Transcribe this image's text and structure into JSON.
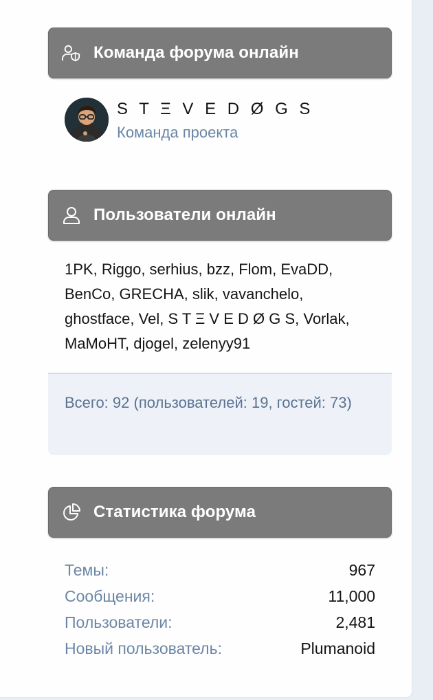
{
  "staff_block": {
    "title": "Команда форума онлайн",
    "icon": "user-shield-icon",
    "members": [
      {
        "name": "S T Ξ V E D Ø G S",
        "role": "Команда проекта"
      }
    ]
  },
  "online_block": {
    "title": "Пользователи онлайн",
    "icon": "user-icon",
    "users": [
      "1PK",
      "Riggo",
      "serhius",
      "bzz",
      "Flom",
      "EvaDD",
      "BenCo",
      "GRECHA",
      "slik",
      "vavanchelo",
      "ghostface",
      "Vel",
      "S T Ξ V E D Ø G S",
      "Vorlak",
      "MaMoHT",
      "djogel",
      "zelenyy91"
    ],
    "total_text": "Всего: 92 (пользователей: 19, гостей: 73)"
  },
  "stats_block": {
    "title": "Статистика форума",
    "icon": "pie-chart-icon",
    "rows": [
      {
        "label": "Темы:",
        "value": "967"
      },
      {
        "label": "Сообщения:",
        "value": "11,000"
      },
      {
        "label": "Пользователи:",
        "value": "2,481"
      },
      {
        "label": "Новый пользователь:",
        "value": "Plumanoid"
      }
    ]
  },
  "colors": {
    "header_bg": "#7b7b7b",
    "link_muted": "#6a86a6",
    "footer_bg": "#eef2f8"
  }
}
